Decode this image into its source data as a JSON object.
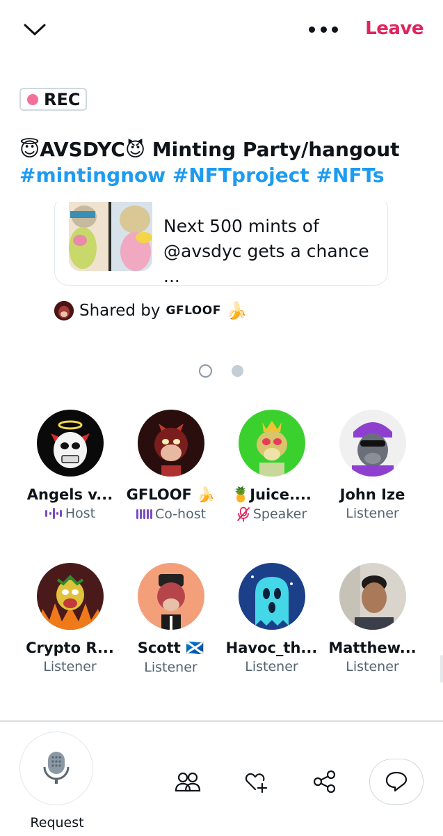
{
  "topbar": {
    "collapse_icon": "chevron-down-icon",
    "more_icon": "more-horizontal-icon",
    "leave_label": "Leave",
    "leave_color": "#e0245e"
  },
  "recording": {
    "label": "REC",
    "dot_color": "#f3709b"
  },
  "space": {
    "title_line1": "😇AVSDYC😈 Minting Party/hangout",
    "title_line2": "#mintingnow #NFTproject #NFTs",
    "hashtag_color": "#1d9bf0"
  },
  "shared_card": {
    "text_line1": "Next 500 mints of",
    "text_line2": "@avsdyc gets a chance ..."
  },
  "shared_by": {
    "prefix": "Shared by",
    "name": "GFLOOF",
    "emoji": "🍌"
  },
  "pager": {
    "total": 2,
    "active": 2
  },
  "participants": [
    {
      "name": "Angels v...",
      "role": "Host",
      "role_icon": "audio-wave-icon"
    },
    {
      "name": "GFLOOF 🍌",
      "role": "Co-host",
      "role_icon": "audio-bars-icon"
    },
    {
      "name": "🍍Juice....",
      "role": "Speaker",
      "role_icon": "mic-muted-icon"
    },
    {
      "name": "John Ize",
      "role": "Listener"
    },
    {
      "name": "Crypto R...",
      "role": "Listener"
    },
    {
      "name": "Scott 🏴󠁧󠁢󠁳󠁣󠁴󠁿",
      "role": "Listener"
    },
    {
      "name": "Havoc_th...",
      "role": "Listener"
    },
    {
      "name": "Matthew...",
      "role": "Listener"
    }
  ],
  "bottombar": {
    "request_label": "Request",
    "mic_icon": "microphone-icon",
    "people_icon": "people-icon",
    "react_icon": "heart-plus-icon",
    "share_icon": "share-icon",
    "chat_icon": "chat-bubble-icon"
  }
}
